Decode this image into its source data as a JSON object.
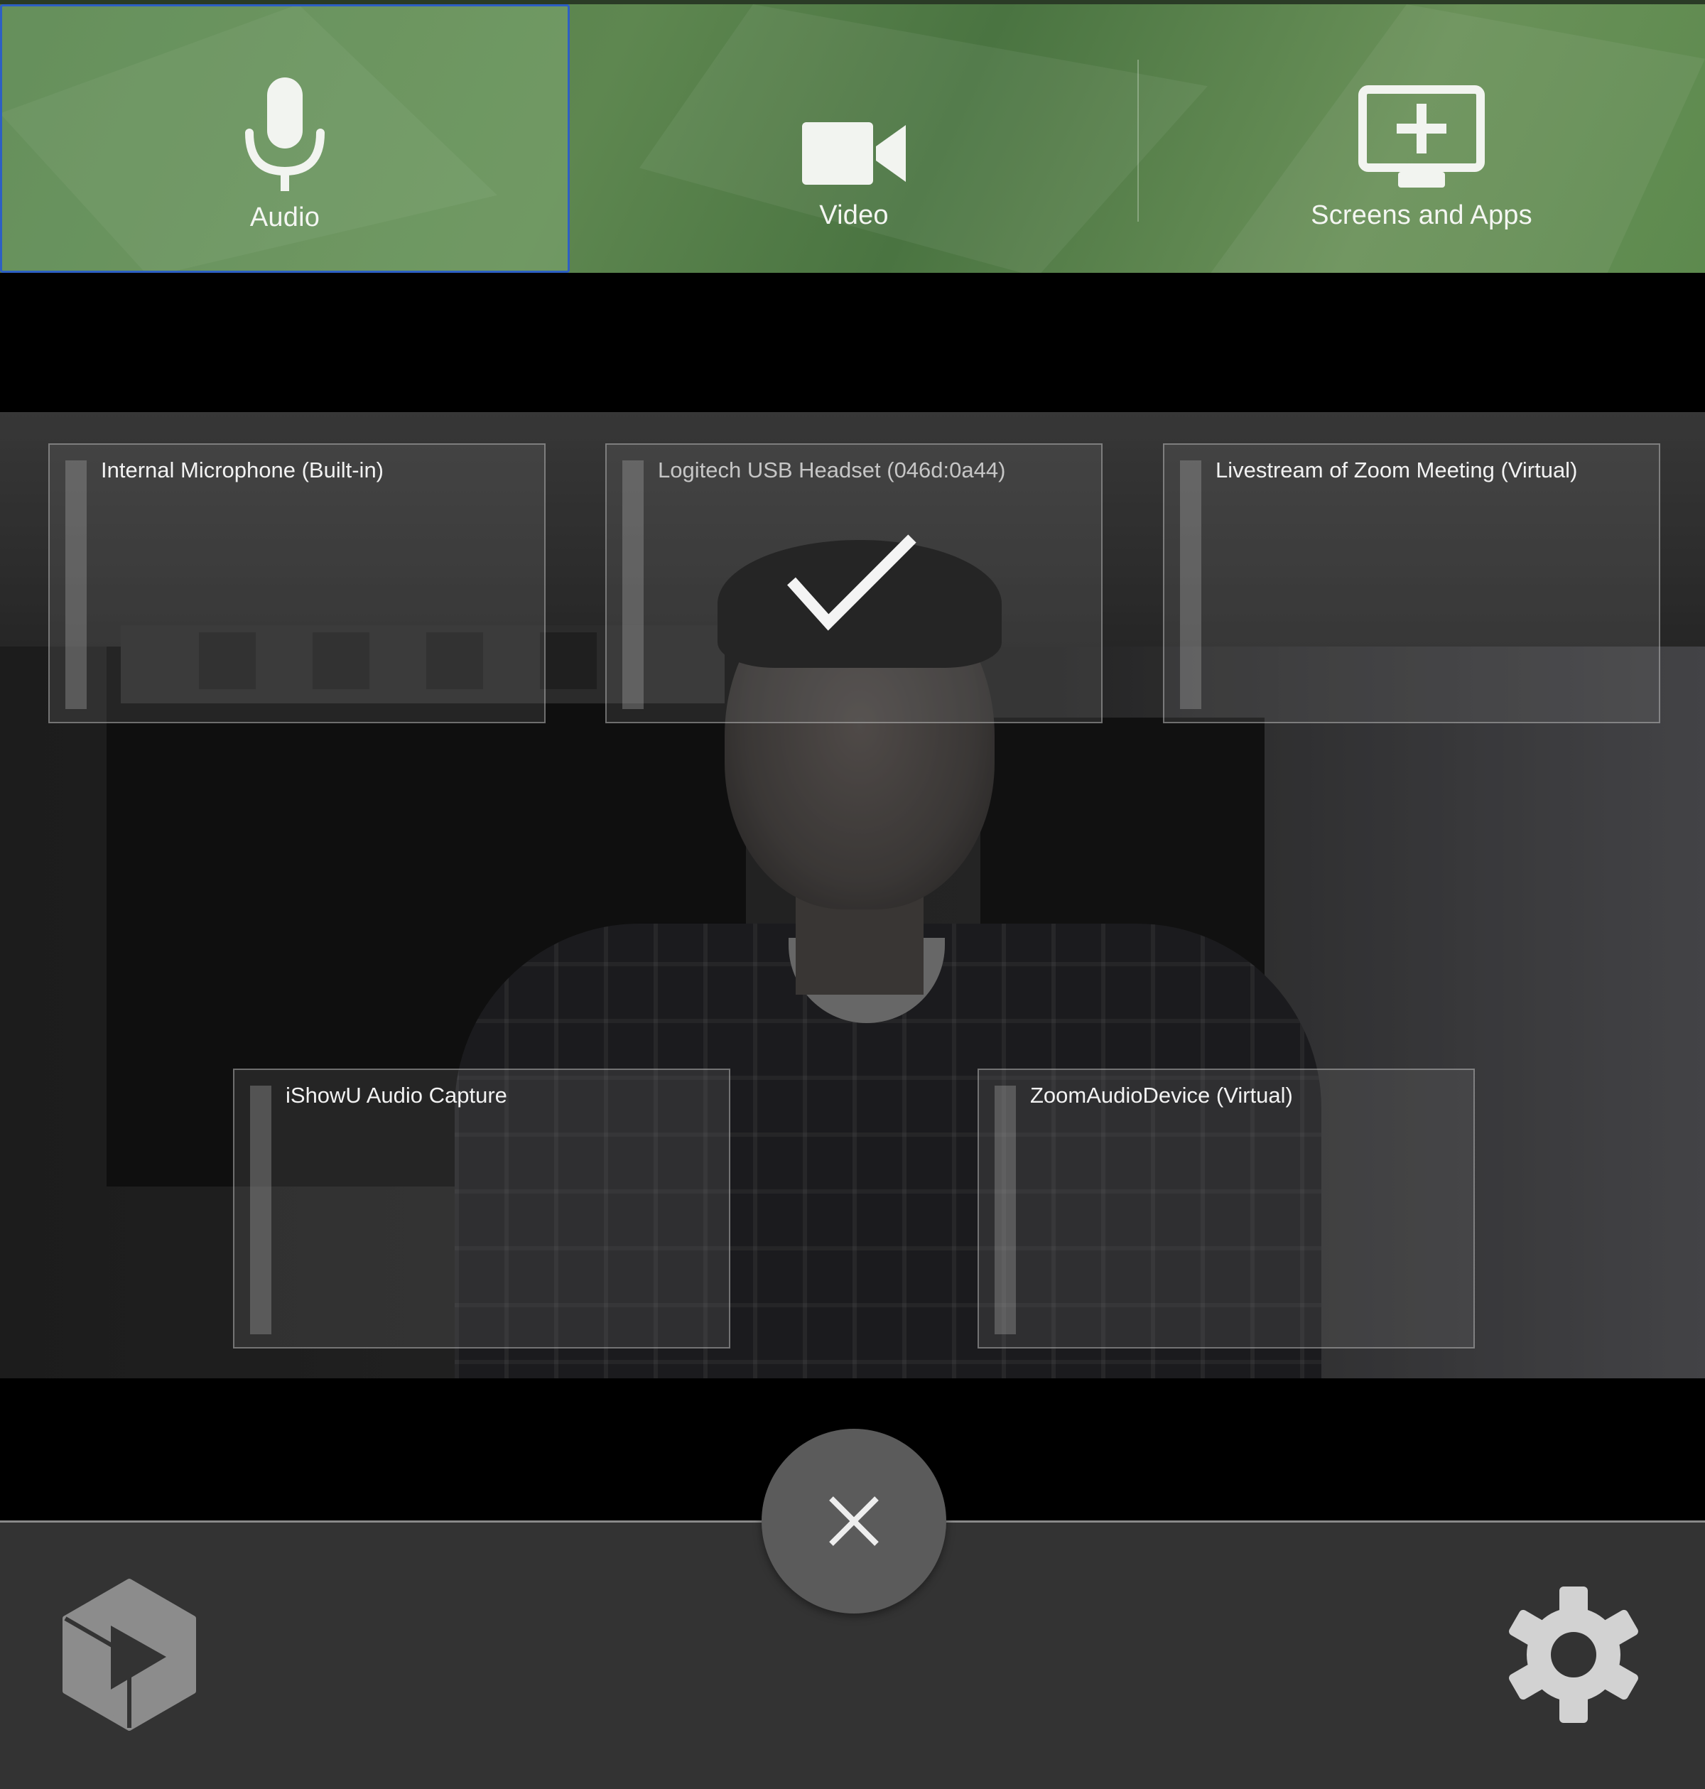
{
  "tabs": [
    {
      "label": "Audio",
      "icon": "microphone-icon",
      "active": true
    },
    {
      "label": "Video",
      "icon": "video-camera-icon",
      "active": false
    },
    {
      "label": "Screens and Apps",
      "icon": "add-screen-icon",
      "active": false
    }
  ],
  "audio_devices": [
    {
      "name": "Internal Microphone (Built-in)",
      "selected": false
    },
    {
      "name": "Logitech USB Headset (046d:0a44)",
      "selected": true
    },
    {
      "name": "Livestream of Zoom Meeting (Virtual)",
      "selected": false
    },
    {
      "name": "iShowU Audio Capture",
      "selected": false
    },
    {
      "name": "ZoomAudioDevice (Virtual)",
      "selected": false
    }
  ],
  "controls": {
    "close_icon": "close-icon",
    "logo_icon": "panopto-logo-icon",
    "settings_icon": "gear-icon"
  },
  "colors": {
    "tab_bar_green": "#5e8750",
    "active_tab_border": "#2d5fc4",
    "bottom_bar": "#333333",
    "close_button": "#5b5b5b"
  }
}
